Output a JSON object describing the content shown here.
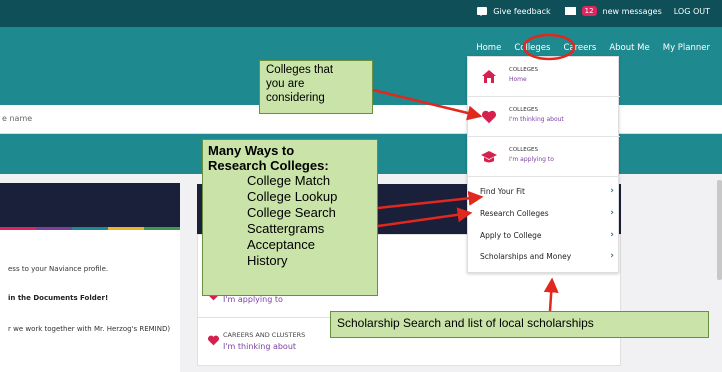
{
  "topbar": {
    "feedback": "Give feedback",
    "message_count": "12",
    "messages_label": "new messages",
    "logout": "LOG OUT"
  },
  "nav": {
    "items": [
      "Home",
      "Colleges",
      "Careers",
      "About Me",
      "My Planner"
    ],
    "highlighted": "Colleges"
  },
  "search": {
    "value": "e name"
  },
  "dropdown": {
    "items": [
      {
        "title": "COLLEGES",
        "sub": "Home"
      },
      {
        "title": "COLLEGES",
        "sub": "I'm thinking about"
      },
      {
        "title": "COLLEGES",
        "sub": "I'm applying to"
      }
    ],
    "links": [
      "Find Your Fit",
      "Research Colleges",
      "Apply to College",
      "Scholarships and Money"
    ]
  },
  "left_panel": {
    "line1": "ess to your Naviance profile.",
    "line2": "in the Documents Folder!",
    "line3": "r we work together with Mr. Herzog's REMIND)"
  },
  "main": {
    "row1_sub": "I'm applying to",
    "row2_title": "CAREERS AND CLUSTERS",
    "row2_sub": "I'm thinking about"
  },
  "annotations": {
    "note1": [
      "Colleges that",
      "you are",
      "considering"
    ],
    "note2_title": [
      "Many Ways to",
      "Research Colleges:"
    ],
    "note2_items": [
      "College Match",
      "College Lookup",
      "College Search",
      "Scattergrams",
      "Acceptance",
      "History"
    ],
    "note3": "Scholarship Search and list of local scholarships"
  },
  "colors": {
    "topbar": "#0f4f58",
    "header": "#1e8a8f",
    "accent_purple": "#7b3fa0",
    "heart": "#d6204e",
    "note_bg": "#c9e3a8",
    "arrow": "#e0281e"
  },
  "icons": [
    "feedback-icon",
    "mail-icon",
    "house-icon",
    "heart-icon",
    "graduation-cap-icon",
    "chevron-right-icon"
  ]
}
